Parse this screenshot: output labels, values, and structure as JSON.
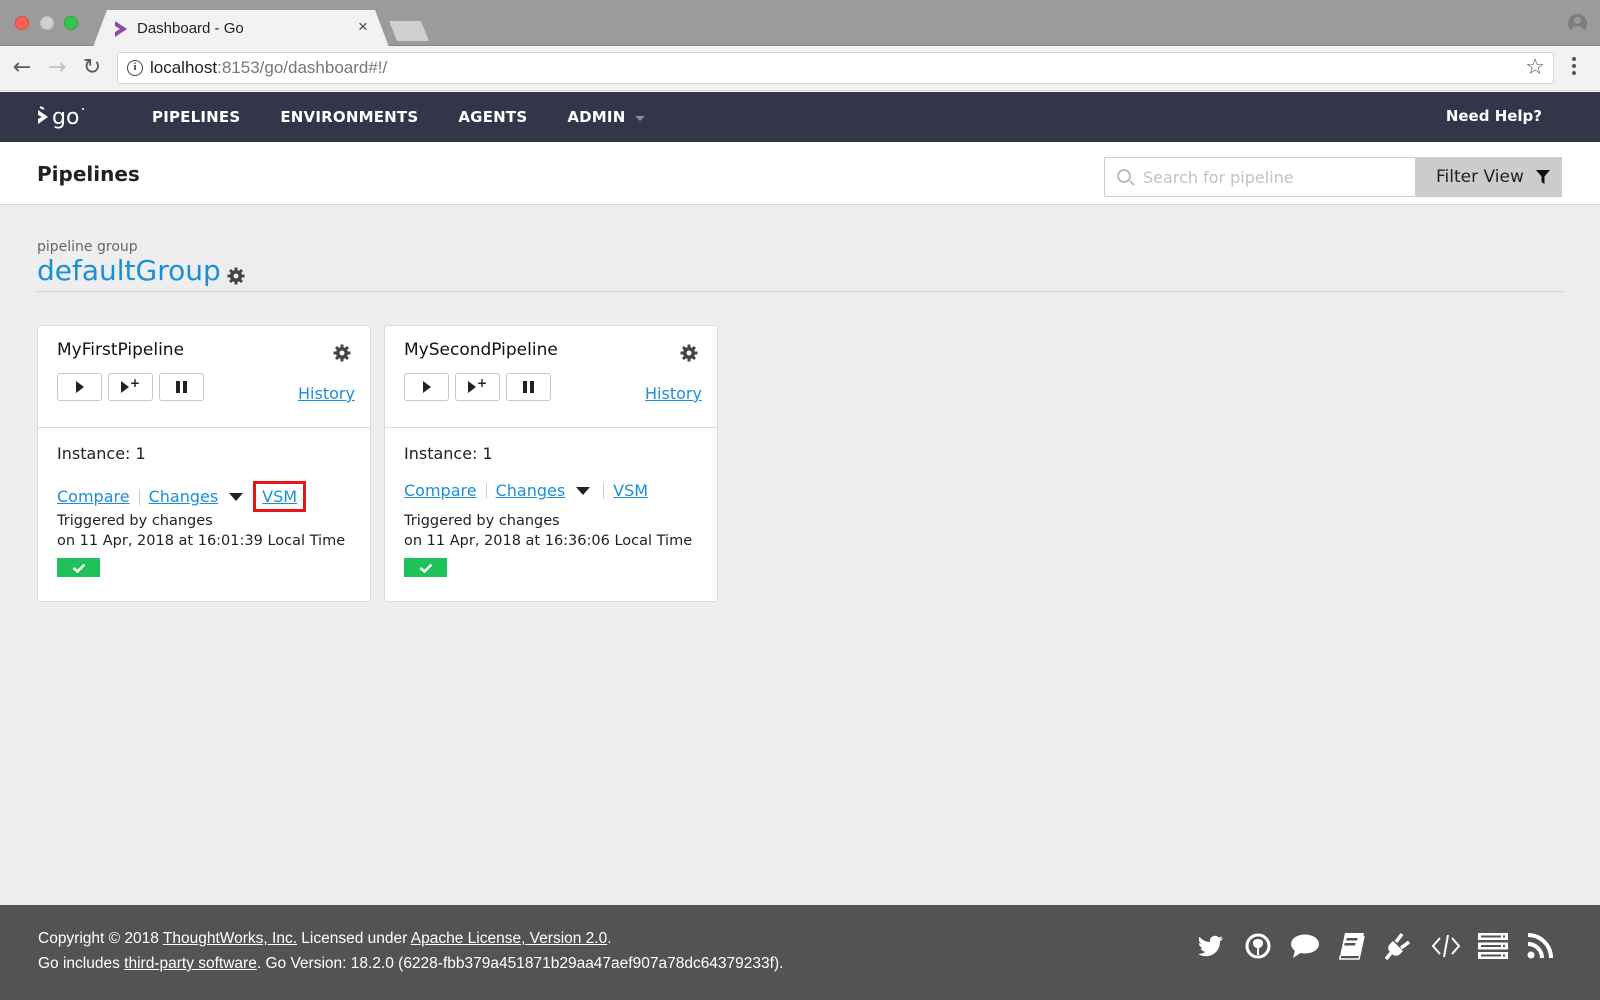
{
  "browser": {
    "tab_title": "Dashboard - Go",
    "tab_close": "×",
    "url_host": "localhost",
    "url_rest": ":8153/go/dashboard#!/",
    "back": "←",
    "forward": "→",
    "reload": "↻",
    "info": "i",
    "star": "☆"
  },
  "header": {
    "nav": [
      {
        "label": "PIPELINES"
      },
      {
        "label": "ENVIRONMENTS"
      },
      {
        "label": "AGENTS"
      },
      {
        "label": "ADMIN",
        "has_dropdown": true
      }
    ],
    "help": "Need Help?"
  },
  "page": {
    "title": "Pipelines",
    "search": {
      "placeholder": "Search for pipeline",
      "value": ""
    },
    "filter_label": "Filter View"
  },
  "group": {
    "label": "pipeline group",
    "name": "defaultGroup"
  },
  "pipelines": [
    {
      "name": "MyFirstPipeline",
      "history": "History",
      "instance": "Instance: 1",
      "compare": "Compare",
      "changes": "Changes",
      "vsm": "VSM",
      "vsm_highlighted": true,
      "trigger_line1": "Triggered by changes",
      "trigger_line2": "on 11 Apr, 2018 at 16:01:39 Local Time",
      "stage_status": "passed",
      "stage_color": "#1fc15a"
    },
    {
      "name": "MySecondPipeline",
      "history": "History",
      "instance": "Instance: 1",
      "compare": "Compare",
      "changes": "Changes",
      "vsm": "VSM",
      "vsm_highlighted": false,
      "trigger_line1": "Triggered by changes",
      "trigger_line2": "on 11 Apr, 2018 at 16:36:06 Local Time",
      "stage_status": "passed",
      "stage_color": "#1fc15a"
    }
  ],
  "footer": {
    "copyright_prefix": "Copyright © 2018 ",
    "company": "ThoughtWorks, Inc.",
    "licensed": " Licensed under ",
    "license": "Apache License, Version 2.0",
    "period": ".",
    "includes": "Go includes ",
    "third_party": "third-party software",
    "version": ". Go Version: 18.2.0 (6228-fbb379a451871b29aa47aef907a78dc64379233f).",
    "icons": [
      "twitter-icon",
      "github-icon",
      "chat-icon",
      "book-icon",
      "plugin-icon",
      "code-icon",
      "server-icon",
      "rss-icon"
    ]
  },
  "colors": {
    "header_bg": "#333649",
    "link": "#1a8fd8",
    "success": "#1fc15a",
    "highlight": "#e8141b",
    "footer_bg": "#535353"
  }
}
